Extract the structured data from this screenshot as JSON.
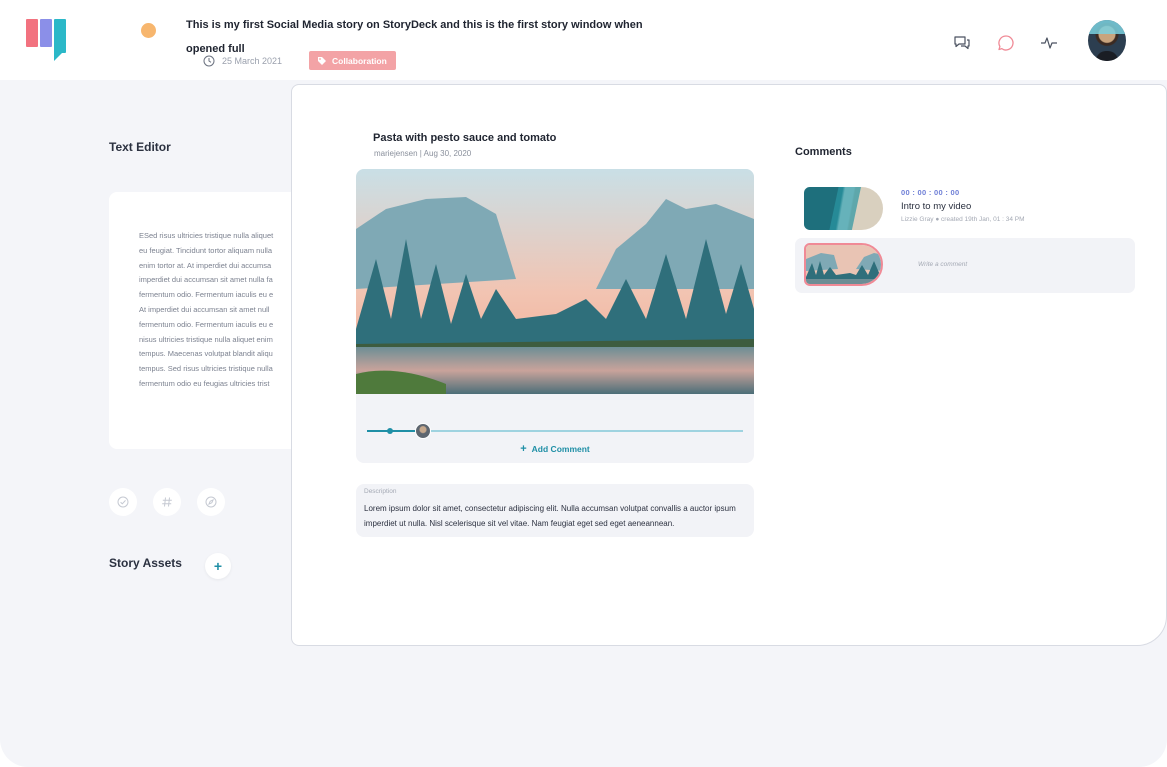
{
  "header": {
    "story_title": "This is my first Social Media story on StoryDeck and this is the first story window when opened full",
    "date": "25 March 2021",
    "tag_label": "Collaboration",
    "icons": [
      "chat-bubbles-icon",
      "comment-icon",
      "activity-icon"
    ],
    "status_color": "#f7b66e",
    "tag_color": "#f3a3a6"
  },
  "left": {
    "text_editor_heading": "Text Editor",
    "editor_lines": [
      "ESed risus ultricies tristique nulla aliquet",
      "eu feugiat. Tincidunt tortor aliquam nulla",
      "enim tortor at. At imperdiet dui accumsa",
      "imperdiet dui accumsan sit amet nulla fa",
      "fermentum odio. Fermentum iaculis eu e",
      "At imperdiet dui accumsan sit amet null",
      "fermentum odio. Fermentum iaculis eu e",
      "nisus ultricies tristique nulla aliquet enim",
      "tempus. Maecenas volutpat blandit aliqu",
      "tempus. Sed risus ultricies tristique nulla",
      "fermentum odio eu feugias ultricies trist"
    ],
    "tools": [
      "check-circle-icon",
      "hash-icon",
      "compass-icon"
    ],
    "story_assets_heading": "Story Assets",
    "add_asset_label": "+"
  },
  "post": {
    "title": "Pasta with pesto sauce and tomato",
    "author_date": "mariejensen  |  Aug 30, 2020",
    "playback_progress": 0.14,
    "add_comment_label": "Add Comment",
    "description_label": "Description",
    "description_text": "Lorem ipsum dolor sit amet, consectetur adipiscing elit. Nulla accumsan volutpat convallis a auctor ipsum imperdiet ut nulla. Nisl scelerisque sit vel vitae. Nam feugiat eget sed eget aeneannean."
  },
  "comments": {
    "heading": "Comments",
    "items": [
      {
        "time": "00 : 00 : 00 : 00",
        "title": "Intro to my video",
        "meta": "Lizzie Gray ● created 19th Jan, 01 : 34 PM"
      }
    ],
    "write_placeholder": "Write a comment"
  },
  "colors": {
    "accent": "#1f8fa6",
    "highlight": "#f08a96",
    "time_color": "#6f7fd6"
  }
}
